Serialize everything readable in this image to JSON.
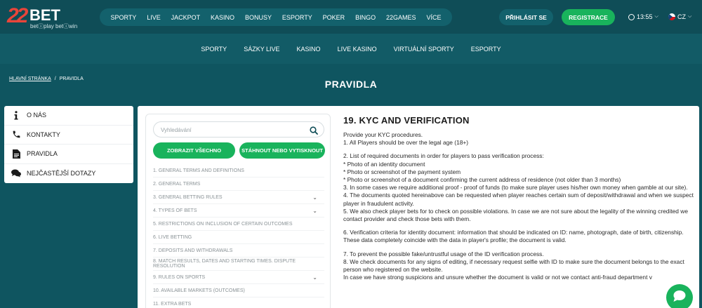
{
  "header": {
    "logo_number": "22",
    "logo_brand": "BET",
    "logo_tagline": "betⓘplay betⓘwin",
    "nav": [
      "SPORTY",
      "LIVE",
      "JACKPOT",
      "KASINO",
      "BONUSY",
      "ESPORTY",
      "POKER",
      "BINGO",
      "22GAMES",
      "VÍCE"
    ],
    "login_label": "PŘIHLÁSIT SE",
    "register_label": "REGISTRACE",
    "time": "13:55",
    "language": "CZ"
  },
  "subnav": [
    "SPORTY",
    "SÁZKY LIVE",
    "KASINO",
    "LIVE KASINO",
    "VIRTUÁLNÍ SPORTY",
    "ESPORTY"
  ],
  "breadcrumb": {
    "home": "HLAVNÍ STRÁNKA",
    "separator": "/",
    "current": "PRAVIDLA"
  },
  "page_title": "PRAVIDLA",
  "sidebar": {
    "items": [
      {
        "label": "O NÁS",
        "icon": "info-icon"
      },
      {
        "label": "KONTAKTY",
        "icon": "phone-icon"
      },
      {
        "label": "PRAVIDLA",
        "icon": "document-icon"
      },
      {
        "label": "NEJČASTĚJŠÍ DOTAZY",
        "icon": "chat-bubbles-icon"
      }
    ]
  },
  "toc": {
    "search_placeholder": "Vyhledávání",
    "show_all_label": "ZOBRAZIT VŠECHNO",
    "download_label": "STÁHNOUT NEBO VYTISKNOUT",
    "items": [
      {
        "label": "1. GENERAL TERMS AND DEFINITIONS",
        "expandable": false
      },
      {
        "label": "2. GENERAL TERMS",
        "expandable": false
      },
      {
        "label": "3. GENERAL BETTING RULES",
        "expandable": true
      },
      {
        "label": "4. TYPES OF BETS",
        "expandable": true
      },
      {
        "label": "5. RESTRICTIONS ON INCLUSION OF CERTAIN OUTCOMES",
        "expandable": false
      },
      {
        "label": "6. LIVE BETTING",
        "expandable": false
      },
      {
        "label": "7. DEPOSITS AND WITHDRAWALS",
        "expandable": false
      },
      {
        "label": "8. MATCH RESULTS, DATES AND STARTING TIMES. DISPUTE RESOLUTION",
        "expandable": false
      },
      {
        "label": "9. RULES ON SPORTS",
        "expandable": true
      },
      {
        "label": "10. AVAILABLE MARKETS (OUTCOMES)",
        "expandable": false
      },
      {
        "label": "11. EXTRA BETS",
        "expandable": false
      }
    ]
  },
  "article": {
    "title": "19. KYC AND VERIFICATION",
    "blocks": [
      [
        "Provide your KYC procedures.",
        "1. All Players should be over the legal age (18+)"
      ],
      [
        "2. List of required documents in order for players to pass verification process:",
        "* Photo of an identity document",
        "* Photo or screenshot of the payment system",
        "* Photo or screenshot of a document confirming the current address of residence (not older than 3 months)",
        "3. In some cases we require additional proof - proof of funds (to make sure player uses his/her own money when gamble at our site).",
        "4. The documents quoted hereinabove can be requested when player reaches certain sum of deposit/withdrawal and when we suspect player in fraudulent activity.",
        "5. We also check player bets for to check on possible violations. In case we are not sure about the legality of the winning credited we contact provider and check those bets with them."
      ],
      [
        "6. Verification criteria for identity document: information that should be indicated on ID: name, photograph, date of birth, citizenship. These data completely coincide with the data in player's profile; the document is valid."
      ],
      [
        "7. To prevent the possible fake/untrustful usage of the ID verification process.",
        "8. We check documents for any signs of editing, if necessary request selfie with ID to make sure the document belongs to the exact person who registered on the website.",
        "In case we have strong suspicions and unsure whether the document is valid or not we contact anti-fraud department v"
      ]
    ]
  },
  "colors": {
    "header_bg": "#0f4d57",
    "accent_green": "#19b35c",
    "logo_red": "#e9453a"
  }
}
